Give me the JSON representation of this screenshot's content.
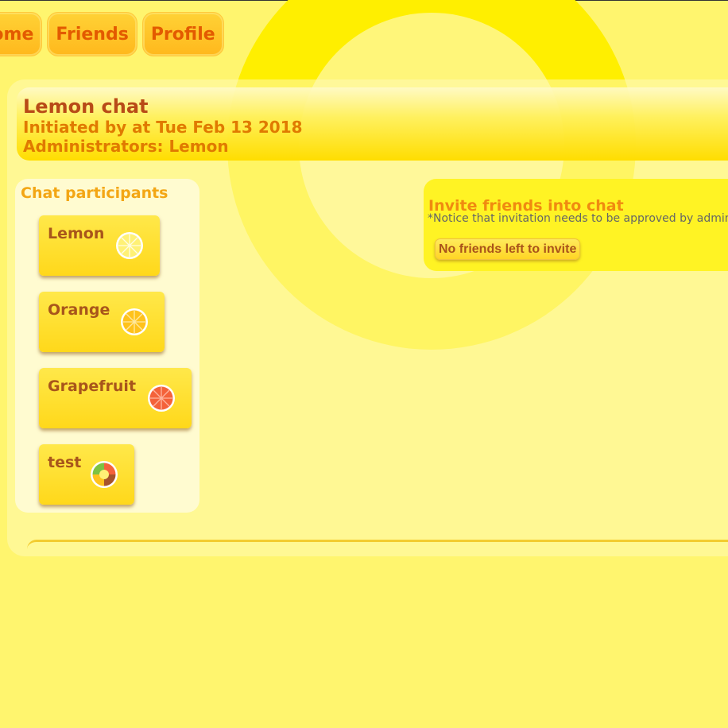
{
  "nav": {
    "items": [
      {
        "label": "Home"
      },
      {
        "label": "Friends"
      },
      {
        "label": "Profile"
      }
    ]
  },
  "chat": {
    "title": "Lemon chat",
    "initiated": "Initiated by at Tue Feb 13 2018",
    "administrators": "Administrators: Lemon"
  },
  "participants": {
    "title": "Chat participants",
    "items": [
      {
        "name": "Lemon",
        "icon": "lemon-slice-icon"
      },
      {
        "name": "Orange",
        "icon": "orange-slice-icon"
      },
      {
        "name": "Grapefruit",
        "icon": "grapefruit-slice-icon"
      },
      {
        "name": "test",
        "icon": "mixed-fruit-slice-icon"
      }
    ]
  },
  "invite": {
    "title": "Invite friends into chat",
    "notice": "*Notice that invitation needs to be approved by admin",
    "button_label": "No friends left to invite"
  },
  "colors": {
    "background": "#fff56e",
    "accent_orange": "#e35a00",
    "title_brown": "#b84a17"
  }
}
